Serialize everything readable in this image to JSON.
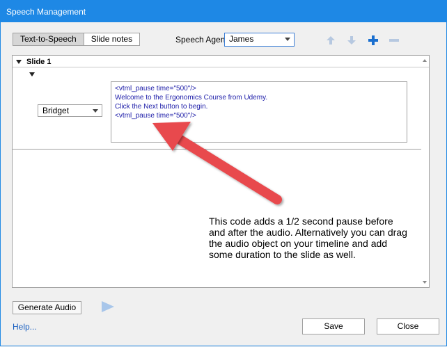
{
  "window": {
    "title": "Speech Management"
  },
  "tabs": [
    {
      "label": "Text-to-Speech",
      "active": true
    },
    {
      "label": "Slide notes",
      "active": false
    }
  ],
  "speech_agent": {
    "label": "Speech Agent",
    "selected": "James"
  },
  "toolbar_icons": [
    "move-up-icon",
    "move-down-icon",
    "add-icon",
    "remove-icon"
  ],
  "slide": {
    "title": "Slide 1",
    "speaker": "Bridget",
    "script_lines": [
      "<vtml_pause time=\"500\"/>",
      "Welcome to the Ergonomics Course from Udemy.",
      "Click the Next button to begin.",
      "<vtml_pause time=\"500\"/>"
    ]
  },
  "annotation": {
    "text": "This code adds a 1/2 second pause before and after the audio. Alternatively you can drag the audio object on your timeline and add some duration to the slide as well."
  },
  "buttons": {
    "generate_audio": "Generate Audio",
    "help": "Help...",
    "save": "Save",
    "close": "Close"
  },
  "colors": {
    "titlebar": "#1e88e5",
    "script_text": "#1c1ca8",
    "annotation_arrow": "#e8484e",
    "add_icon": "#1a6fcf",
    "link": "#1a5fc0"
  }
}
